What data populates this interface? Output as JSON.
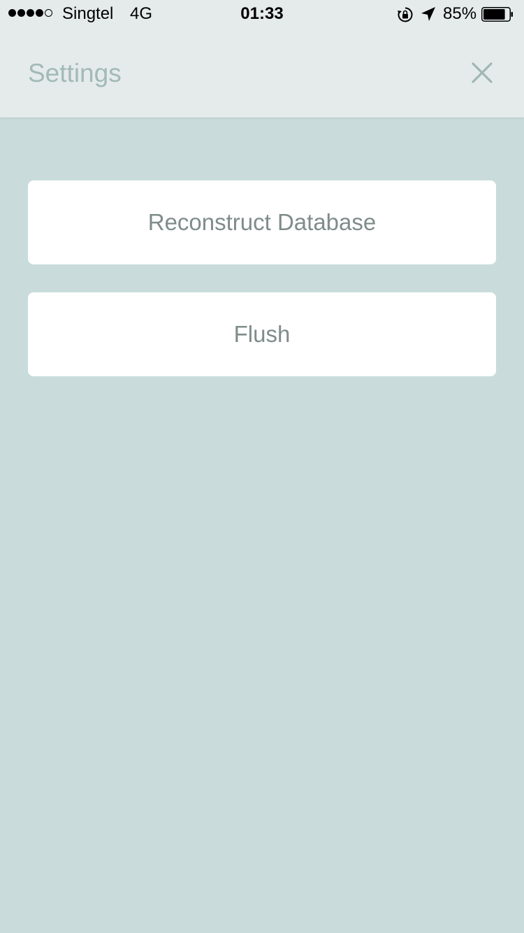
{
  "status_bar": {
    "signal_dots_filled": 4,
    "signal_dots_total": 5,
    "carrier": "Singtel",
    "network": "4G",
    "time": "01:33",
    "battery_percent_label": "85%",
    "battery_level": 0.85,
    "icons": [
      "rotation-lock-icon",
      "location-arrow-icon",
      "battery-icon"
    ]
  },
  "header": {
    "title": "Settings",
    "close_icon": "close-icon"
  },
  "actions": {
    "reconstruct_label": "Reconstruct Database",
    "flush_label": "Flush"
  },
  "colors": {
    "background": "#c9dcdb",
    "header_background": "#e5ebeb",
    "title_color": "#a2bab6",
    "button_background": "#ffffff",
    "button_text": "#7f8c8b"
  }
}
